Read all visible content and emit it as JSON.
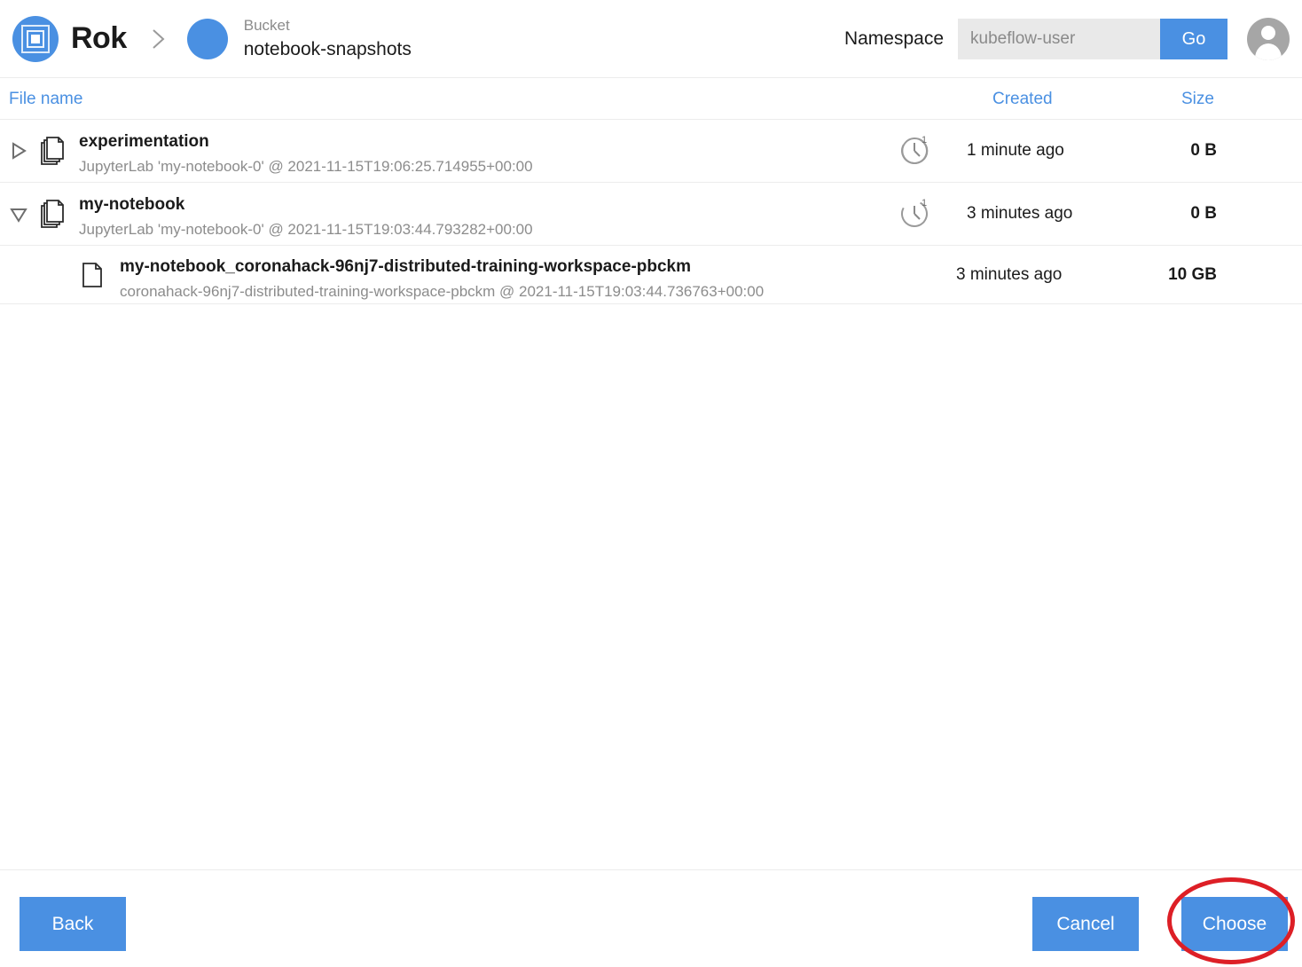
{
  "header": {
    "brand_name": "Rok",
    "logo_icon": "rok-logo-icon",
    "separator_icon": "chevron-right-icon",
    "bucket_kind_label": "Bucket",
    "bucket_name": "notebook-snapshots",
    "namespace_label": "Namespace",
    "namespace_value": "kubeflow-user",
    "namespace_placeholder": "kubeflow-user",
    "go_label": "Go",
    "avatar_icon": "user-avatar-icon"
  },
  "columns": {
    "file_name": "File name",
    "created": "Created",
    "size": "Size"
  },
  "rows": [
    {
      "expander_icon": "triangle-right-icon",
      "expanded": false,
      "file_icon": "document-stack-icon",
      "title": "experimentation",
      "subtitle": "JupyterLab 'my-notebook-0' @ 2021-11-15T19:06:25.714955+00:00",
      "version_icon": "clock-version-icon",
      "version_count": "1",
      "created": "1 minute ago",
      "size": "0 B"
    },
    {
      "expander_icon": "triangle-down-icon",
      "expanded": true,
      "file_icon": "document-stack-icon",
      "title": "my-notebook",
      "subtitle": "JupyterLab 'my-notebook-0' @ 2021-11-15T19:03:44.793282+00:00",
      "version_icon": "clock-version-icon",
      "version_count": "1",
      "created": "3 minutes ago",
      "size": "0 B"
    },
    {
      "child": true,
      "file_icon": "document-icon",
      "title": "my-notebook_coronahack-96nj7-distributed-training-workspace-pbckm",
      "subtitle": "coronahack-96nj7-distributed-training-workspace-pbckm @ 2021-11-15T19:03:44.736763+00:00",
      "created": "3 minutes ago",
      "size": "10 GB"
    }
  ],
  "footer": {
    "back_label": "Back",
    "cancel_label": "Cancel",
    "choose_label": "Choose"
  },
  "annotation": {
    "target": "choose-button",
    "shape": "ellipse",
    "color": "#dd1f26"
  },
  "colors": {
    "accent_blue": "#4a90e2",
    "header_link_blue": "#4a90e2",
    "input_grey": "#e9e9e9",
    "text_dark": "#1b1b1b",
    "text_muted": "#8c8c8c",
    "divider": "#ececec",
    "annotation_red": "#dd1f26",
    "avatar_grey": "#a6a6a6"
  }
}
